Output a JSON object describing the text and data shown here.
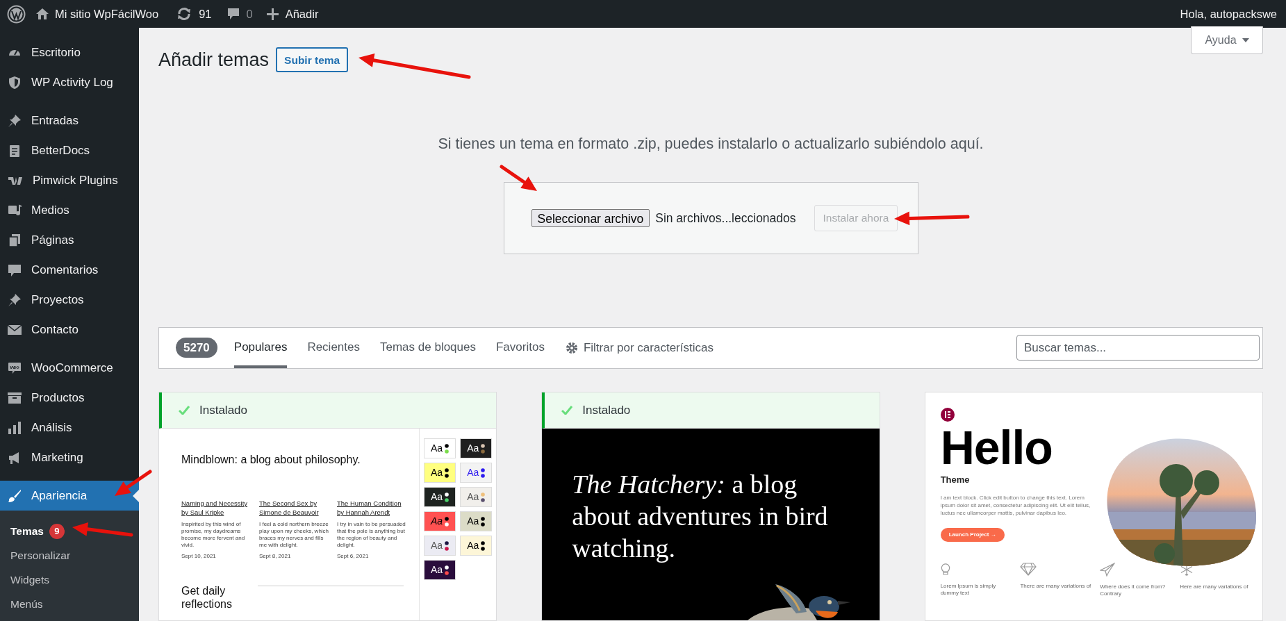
{
  "admin_bar": {
    "site": "Mi sitio WpFácilWoo",
    "updates": "91",
    "comments": "0",
    "new": "Añadir",
    "greeting": "Hola, autopackswe"
  },
  "sidebar": {
    "groups": [
      [
        {
          "label": "Escritorio",
          "selected": false
        },
        {
          "label": "WP Activity Log",
          "selected": false
        }
      ],
      [
        {
          "label": "Entradas",
          "selected": false
        },
        {
          "label": "BetterDocs",
          "selected": false
        },
        {
          "label": "Pimwick Plugins",
          "selected": false
        },
        {
          "label": "Medios",
          "selected": false
        },
        {
          "label": "Páginas",
          "selected": false
        },
        {
          "label": "Comentarios",
          "selected": false
        },
        {
          "label": "Proyectos",
          "selected": false
        },
        {
          "label": "Contacto",
          "selected": false
        }
      ],
      [
        {
          "label": "WooCommerce",
          "selected": false
        },
        {
          "label": "Productos",
          "selected": false
        },
        {
          "label": "Análisis",
          "selected": false
        },
        {
          "label": "Marketing",
          "selected": false
        }
      ],
      [
        {
          "label": "Apariencia",
          "selected": true,
          "children": [
            {
              "label": "Temas",
              "selected": true,
              "badge": "9"
            },
            {
              "label": "Personalizar",
              "selected": false
            },
            {
              "label": "Widgets",
              "selected": false
            },
            {
              "label": "Menús",
              "selected": false
            }
          ]
        }
      ]
    ]
  },
  "help_tab": "Ayuda",
  "page": {
    "title": "Añadir temas",
    "upload_button": "Subir tema"
  },
  "upload": {
    "message": "Si tienes un tema en formato .zip, puedes instalarlo o actualizarlo subiéndolo aquí.",
    "file_button": "Seleccionar archivo",
    "file_status": "Sin archivos...leccionados",
    "install_button": {
      "label": "Instalar ahora",
      "disabled": true
    }
  },
  "filter_bar": {
    "count": "5270",
    "tabs": [
      {
        "label": "Populares",
        "selected": true
      },
      {
        "label": "Recientes",
        "selected": false
      },
      {
        "label": "Temas de bloques",
        "selected": false
      },
      {
        "label": "Favoritos",
        "selected": false
      }
    ],
    "feature_filter": "Filtrar por características",
    "search": {
      "placeholder": "Buscar temas..."
    }
  },
  "themes": [
    {
      "kind": "blog",
      "installed": true,
      "installed_label": "Instalado",
      "heading": "Mindblown: a blog about philosophy.",
      "posts": [
        {
          "title": "Naming and Necessity by Saul Kripke",
          "excerpt": "Inspirited by this wind of promise, my daydreams become more fervent and vivid.",
          "date": "Sept 10, 2021"
        },
        {
          "title": "The Second Sex by Simone de Beauvoir",
          "excerpt": "I feel a cold northern breeze play upon my cheeks, which braces my nerves and fills me with delight.",
          "date": "Sept 8, 2021"
        },
        {
          "title": "The Human Condition by Hannah Arendt",
          "excerpt": "I try in vain to be persuaded that the pole is anything but the region of beauty and delight.",
          "date": "Sept 6, 2021"
        }
      ],
      "subscribe": "Get daily reflections",
      "swatches": [
        {
          "label": "Aa",
          "color": "#ffffff",
          "italic": false
        },
        {
          "label": "Aa",
          "color": "#1f1f1f",
          "italic": false
        },
        {
          "label": "Aa",
          "color": "#ffff7f",
          "italic": false
        },
        {
          "label": "Aa",
          "color": "#f3f3f3",
          "italic": false
        },
        {
          "label": "Aa",
          "color": "#1e2320",
          "italic": false
        },
        {
          "label": "Aa",
          "color": "#f1efeb",
          "italic": false
        },
        {
          "label": "Aa",
          "color": "#ff5151",
          "italic": true
        },
        {
          "label": "Aa",
          "color": "#dcdcc7",
          "italic": false
        },
        {
          "label": "Aa",
          "color": "#ebebf3",
          "italic": false
        },
        {
          "label": "Aa",
          "color": "#fdf6d8",
          "italic": false
        },
        {
          "label": "Aa",
          "color": "#2a0d3c",
          "italic": false
        }
      ]
    },
    {
      "kind": "hatchery",
      "installed": true,
      "installed_label": "Instalado",
      "heading": "*The Hatchery:* a blog about adventures in bird watching."
    },
    {
      "kind": "hello",
      "installed": false,
      "heading": "Hello",
      "subheading": "Theme",
      "body": "I am text block. Click edit button to change this text. Lorem ipsum dolor sit amet, consectetur adipiscing elit. Ut elit tellus, luctus nec ullamcorper mattis, pulvinar dapibus leo.",
      "cta": "Launch Project →",
      "features": [
        {
          "text": "Lorem Ipsum is simply dummy text"
        },
        {
          "text": "There are many variations of"
        },
        {
          "text": "Where does it come from? Contrary"
        },
        {
          "text": "Here are many variations of"
        }
      ]
    }
  ]
}
